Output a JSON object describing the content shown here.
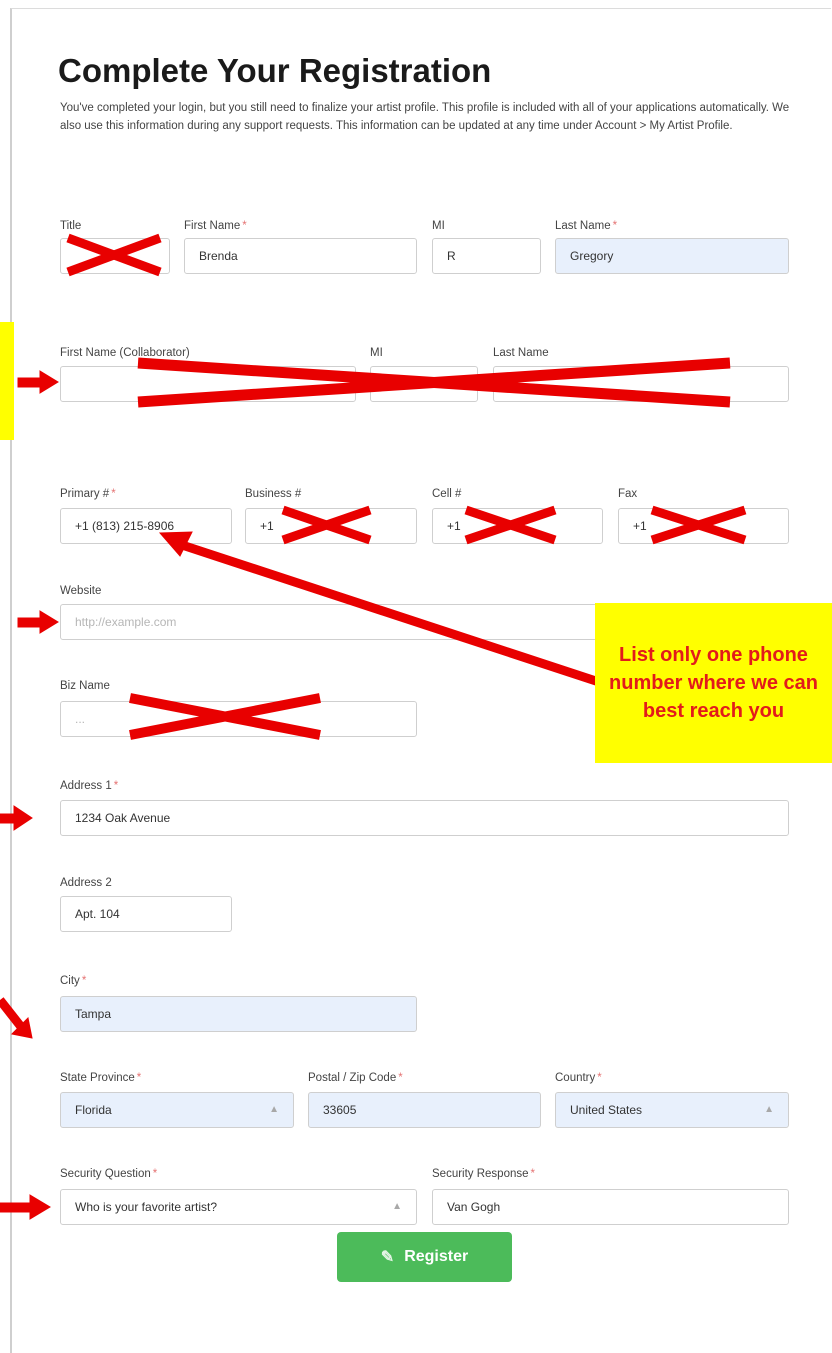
{
  "page": {
    "title": "Complete Your Registration",
    "intro": "You've completed your login, but you still need to finalize your artist profile. This profile is included with all of your applications automatically. We also use this information during any support requests. This information can be updated at any time under Account > My Artist Profile."
  },
  "name_row": {
    "title_label": "Title",
    "first_label": "First Name",
    "first_value": "Brenda",
    "mi_label": "MI",
    "mi_value": "R",
    "last_label": "Last Name",
    "last_value": "Gregory"
  },
  "collaborator_row": {
    "first_label": "First Name (Collaborator)",
    "mi_label": "MI",
    "last_label": "Last Name"
  },
  "phone_row": {
    "primary_label": "Primary #",
    "primary_value": "+1 (813) 215-8906",
    "business_label": "Business #",
    "business_value": "+1",
    "cell_label": "Cell #",
    "cell_value": "+1",
    "fax_label": "Fax",
    "fax_value": "+1"
  },
  "website": {
    "label": "Website",
    "placeholder": "http://example.com"
  },
  "biz_name": {
    "label": "Biz Name",
    "placeholder": "..."
  },
  "address1": {
    "label": "Address 1",
    "value": "1234 Oak Avenue"
  },
  "address2": {
    "label": "Address 2",
    "value": "Apt. 104"
  },
  "city": {
    "label": "City",
    "value": "Tampa"
  },
  "region_row": {
    "state_label": "State Province",
    "state_value": "Florida",
    "postal_label": "Postal / Zip Code",
    "postal_value": "33605",
    "country_label": "Country",
    "country_value": "United States"
  },
  "security_row": {
    "question_label": "Security Question",
    "question_value": "Who is your favorite artist?",
    "response_label": "Security Response",
    "response_value": "Van Gogh"
  },
  "register_label": "Register",
  "annotation": {
    "callout_text": "List only one phone number where we can best reach you"
  },
  "colors": {
    "required_star": "#e57373",
    "register_green": "#4cbb5a",
    "autofill_blue": "#e8f0fc",
    "annotation_red": "#e80000",
    "highlight_yellow": "#ffff00"
  }
}
